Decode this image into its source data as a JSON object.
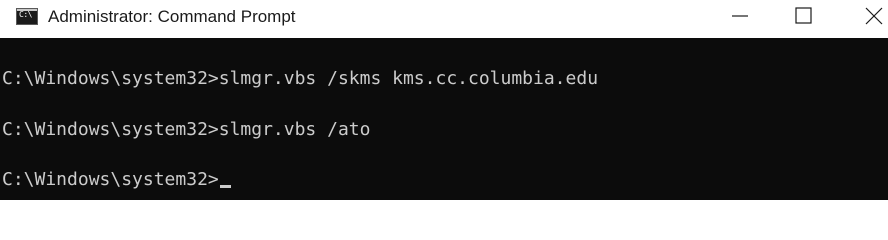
{
  "window": {
    "title": "Administrator: Command Prompt",
    "app_icon_glyph": "C:\\",
    "controls": {
      "minimize": "minimize-icon",
      "maximize": "maximize-icon",
      "close": "close-icon"
    }
  },
  "console": {
    "lines": [
      "C:\\Windows\\system32>slmgr.vbs /skms kms.cc.columbia.edu",
      "C:\\Windows\\system32>slmgr.vbs /ato",
      "C:\\Windows\\system32>"
    ],
    "colors": {
      "background": "#0c0c0c",
      "text": "#cccccc"
    }
  }
}
